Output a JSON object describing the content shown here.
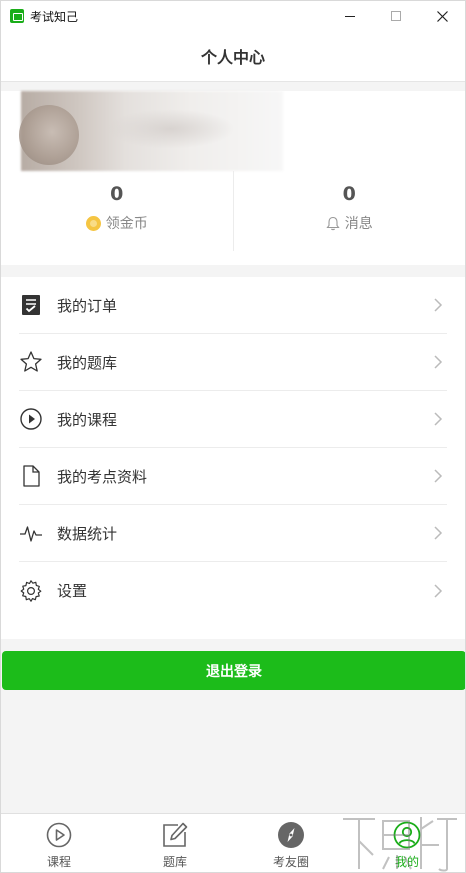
{
  "window": {
    "title": "考试知己",
    "close_symbol": "✕"
  },
  "header": {
    "title": "个人中心"
  },
  "profile": {
    "stats": [
      {
        "value": "0",
        "label": "领金币",
        "icon": "coin-icon"
      },
      {
        "value": "0",
        "label": "消息",
        "icon": "bell-icon"
      }
    ]
  },
  "menu": {
    "items": [
      {
        "label": "我的订单",
        "icon": "order-list-icon"
      },
      {
        "label": "我的题库",
        "icon": "star-icon"
      },
      {
        "label": "我的课程",
        "icon": "play-circle-icon"
      },
      {
        "label": "我的考点资料",
        "icon": "document-icon"
      },
      {
        "label": "数据统计",
        "icon": "pulse-icon"
      },
      {
        "label": "设置",
        "icon": "gear-icon"
      }
    ]
  },
  "logout": {
    "label": "退出登录"
  },
  "tabbar": {
    "items": [
      {
        "label": "课程",
        "icon": "play-circle-icon",
        "active": false
      },
      {
        "label": "题库",
        "icon": "edit-icon",
        "active": false
      },
      {
        "label": "考友圈",
        "icon": "compass-icon",
        "active": false
      },
      {
        "label": "我的",
        "icon": "user-icon",
        "active": true
      }
    ]
  },
  "colors": {
    "accent": "#1aad19",
    "logout_button": "#1cbc1a",
    "background": "#f4f4f4"
  }
}
